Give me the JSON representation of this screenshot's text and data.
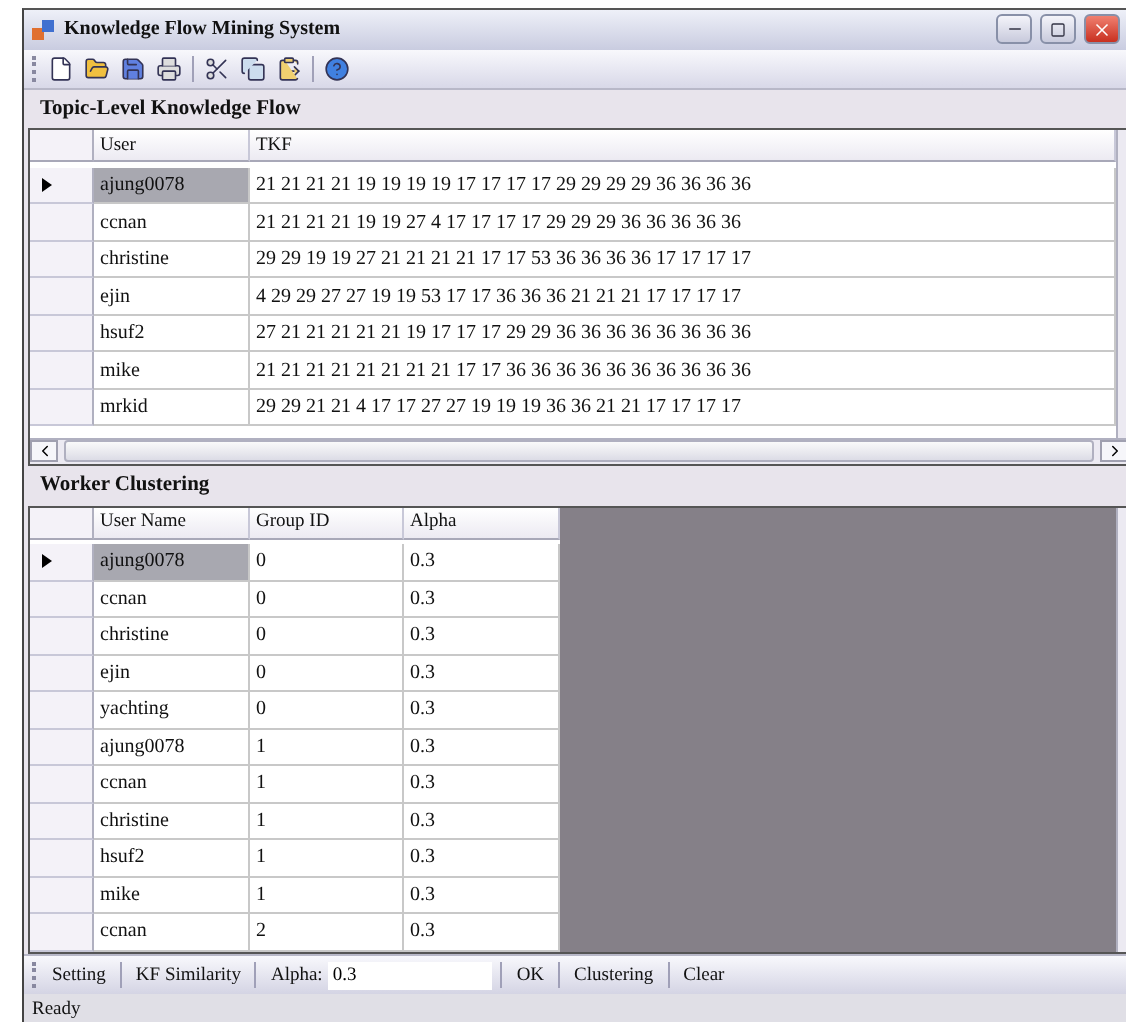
{
  "window": {
    "title": "Knowledge Flow Mining System"
  },
  "topic_panel": {
    "title": "Topic-Level Knowledge Flow",
    "columns": [
      "User",
      "TKF"
    ],
    "rows": [
      {
        "user": "ajung0078",
        "tkf": "21 21 21 21 19 19 19 19 17 17 17 17 29 29 29 29 36 36 36 36",
        "selected": true
      },
      {
        "user": "ccnan",
        "tkf": "21 21 21 21 19 19 27 4 17 17 17 17 29 29 29 36 36 36 36 36",
        "selected": false
      },
      {
        "user": "christine",
        "tkf": "29 29 19 19 27 21 21 21 21 17 17 53 36 36 36 36 17 17 17 17",
        "selected": false
      },
      {
        "user": "ejin",
        "tkf": "4 29 29 27 27 19 19 53 17 17 36 36 36 21 21 21 17 17 17 17",
        "selected": false
      },
      {
        "user": "hsuf2",
        "tkf": "27 21 21 21 21 21 19 17 17 17 29 29 36 36 36 36 36 36 36 36",
        "selected": false
      },
      {
        "user": "mike",
        "tkf": "21 21 21 21 21 21 21 21 17 17 36 36 36 36 36 36 36 36 36 36",
        "selected": false
      },
      {
        "user": "mrkid",
        "tkf": "29 29 21 21 4 17 17 27 27 19 19 19 36 36 21 21 17 17 17 17",
        "selected": false
      }
    ]
  },
  "clustering_panel": {
    "title": "Worker Clustering",
    "columns": [
      "User Name",
      "Group ID",
      "Alpha"
    ],
    "rows": [
      {
        "user": "ajung0078",
        "group": "0",
        "alpha": "0.3",
        "selected": true
      },
      {
        "user": "ccnan",
        "group": "0",
        "alpha": "0.3",
        "selected": false
      },
      {
        "user": "christine",
        "group": "0",
        "alpha": "0.3",
        "selected": false
      },
      {
        "user": "ejin",
        "group": "0",
        "alpha": "0.3",
        "selected": false
      },
      {
        "user": "yachting",
        "group": "0",
        "alpha": "0.3",
        "selected": false
      },
      {
        "user": "ajung0078",
        "group": "1",
        "alpha": "0.3",
        "selected": false
      },
      {
        "user": "ccnan",
        "group": "1",
        "alpha": "0.3",
        "selected": false
      },
      {
        "user": "christine",
        "group": "1",
        "alpha": "0.3",
        "selected": false
      },
      {
        "user": "hsuf2",
        "group": "1",
        "alpha": "0.3",
        "selected": false
      },
      {
        "user": "mike",
        "group": "1",
        "alpha": "0.3",
        "selected": false
      },
      {
        "user": "ccnan",
        "group": "2",
        "alpha": "0.3",
        "selected": false
      }
    ]
  },
  "action_bar": {
    "items": [
      {
        "kind": "button",
        "label": "Setting"
      },
      {
        "kind": "button",
        "label": "KF Similarity"
      },
      {
        "kind": "field",
        "label": "Alpha:",
        "value": "0.3"
      },
      {
        "kind": "button",
        "label": "OK"
      },
      {
        "kind": "button",
        "label": "Clustering"
      },
      {
        "kind": "button",
        "label": "Clear"
      }
    ]
  },
  "status_bar": {
    "text": "Ready"
  }
}
